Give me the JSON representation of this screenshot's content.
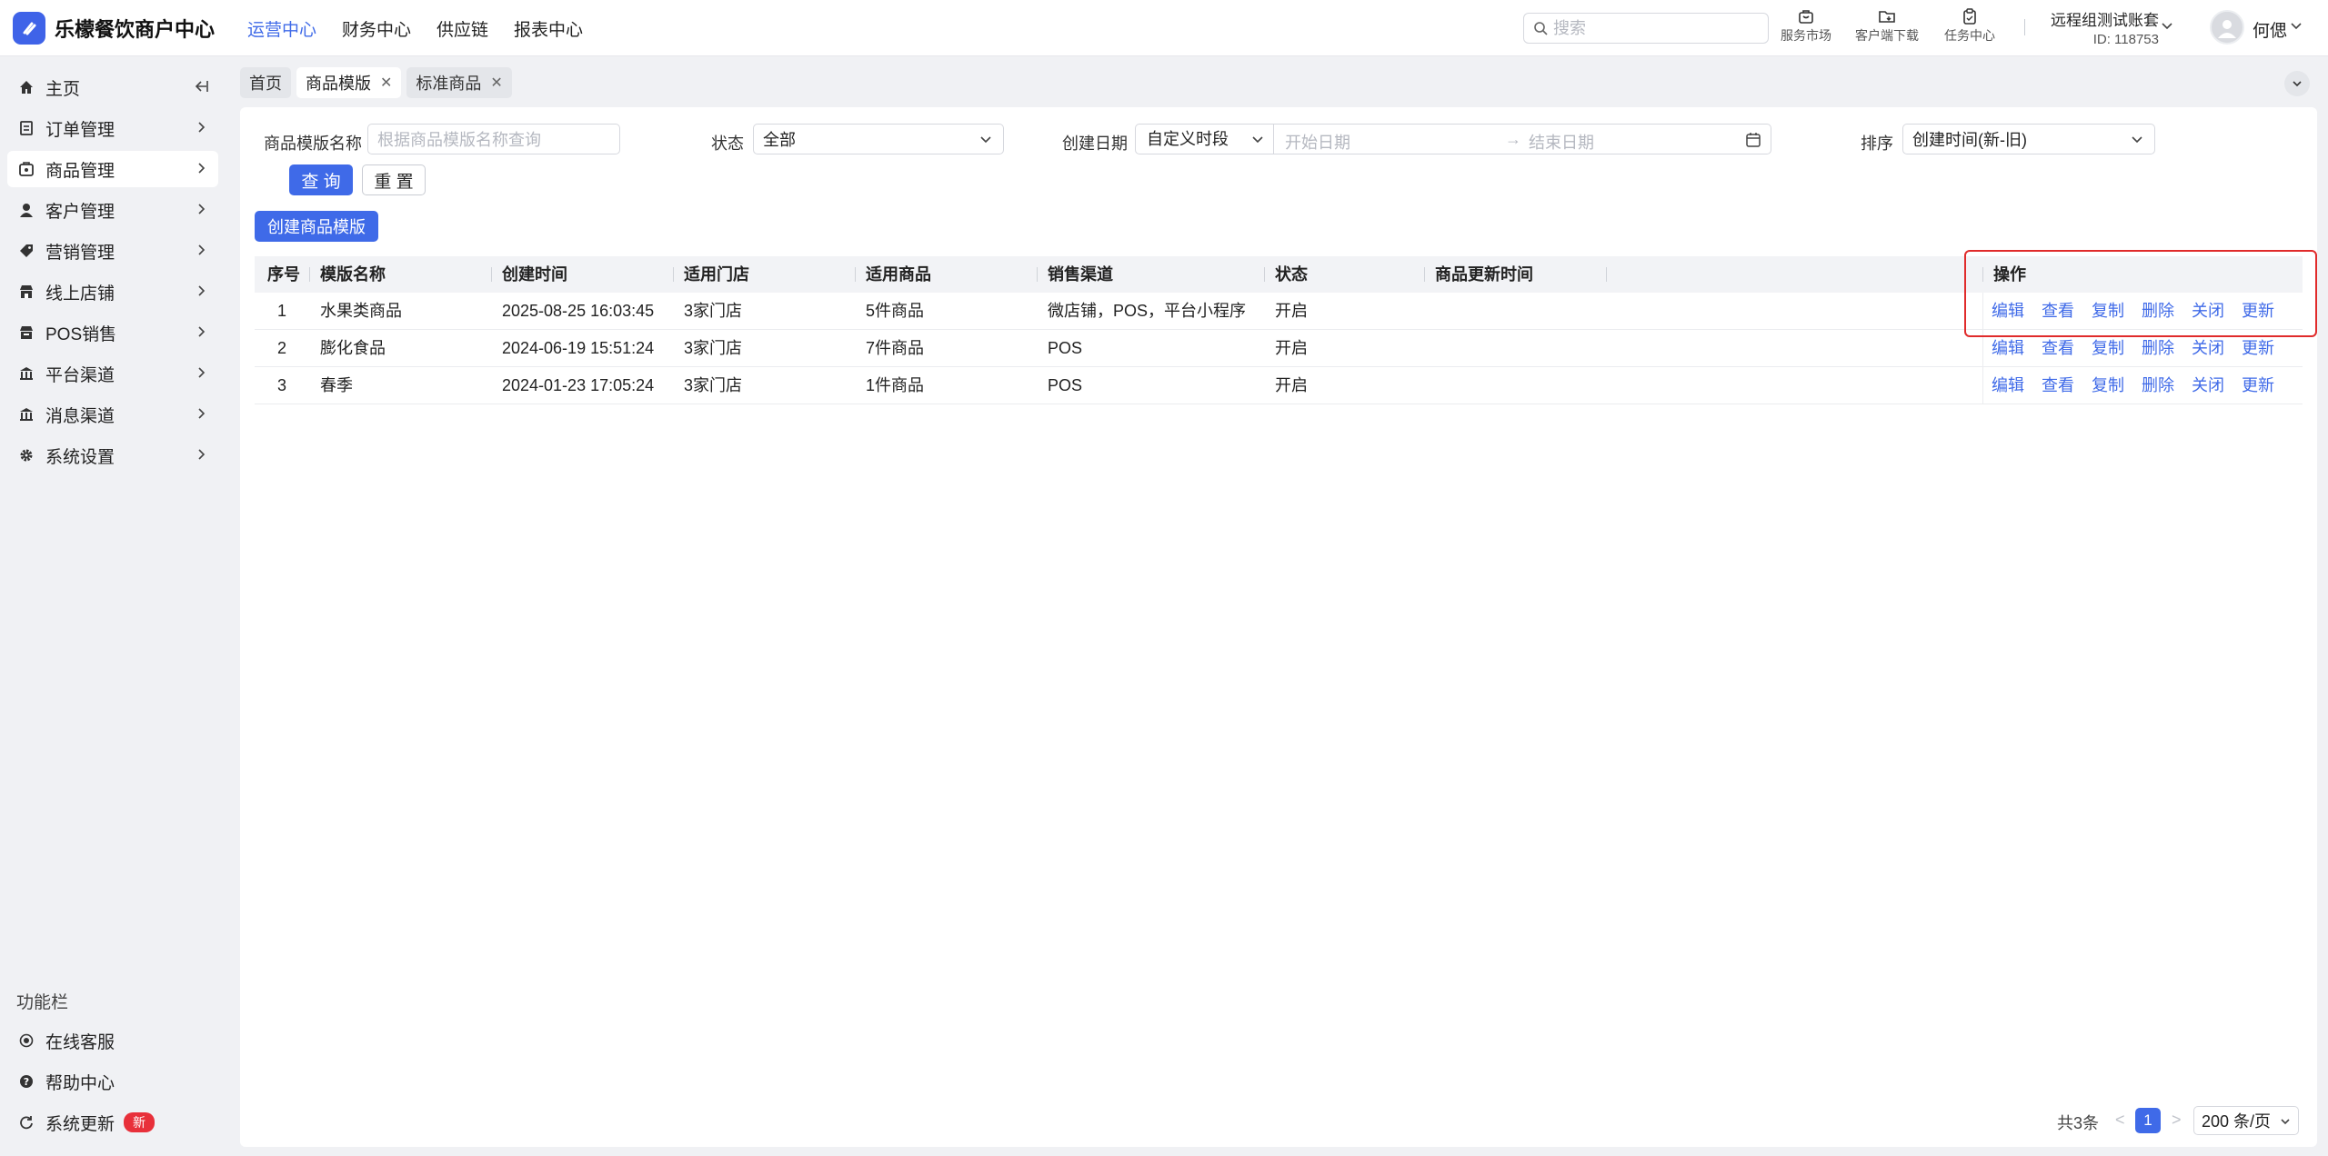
{
  "brand": {
    "name": "乐檬餐饮商户中心"
  },
  "topnav": [
    "运营中心",
    "财务中心",
    "供应链",
    "报表中心"
  ],
  "search": {
    "placeholder": "搜索"
  },
  "tools": [
    "服务市场",
    "客户端下载",
    "任务中心"
  ],
  "account": {
    "name": "远程组测试账套",
    "id": "ID: 118753"
  },
  "user": {
    "name": "何偲"
  },
  "sidebar": {
    "items": [
      {
        "label": "主页",
        "icon": "home-icon"
      },
      {
        "label": "订单管理",
        "icon": "order-icon"
      },
      {
        "label": "商品管理",
        "icon": "product-icon"
      },
      {
        "label": "客户管理",
        "icon": "user-icon"
      },
      {
        "label": "营销管理",
        "icon": "tag-icon"
      },
      {
        "label": "线上店铺",
        "icon": "shop-icon"
      },
      {
        "label": "POS销售",
        "icon": "pos-icon"
      },
      {
        "label": "平台渠道",
        "icon": "bank-icon"
      },
      {
        "label": "消息渠道",
        "icon": "message-icon"
      },
      {
        "label": "系统设置",
        "icon": "gear-icon"
      }
    ],
    "func_title": "功能栏",
    "func_items": [
      {
        "label": "在线客服",
        "icon": "headset-icon"
      },
      {
        "label": "帮助中心",
        "icon": "help-icon"
      },
      {
        "label": "系统更新",
        "icon": "refresh-icon",
        "badge": "新"
      }
    ]
  },
  "tabs": [
    "首页",
    "商品模版",
    "标准商品"
  ],
  "filters": {
    "name_label": "商品模版名称",
    "name_placeholder": "根据商品模版名称查询",
    "status_label": "状态",
    "status_value": "全部",
    "date_label": "创建日期",
    "date_type": "自定义时段",
    "start_placeholder": "开始日期",
    "end_placeholder": "结束日期",
    "date_arrow": "→",
    "sort_label": "排序",
    "sort_value": "创建时间(新-旧)",
    "query_button": "查 询",
    "reset_button": "重 置",
    "create_button": "创建商品模版"
  },
  "table": {
    "columns": [
      "序号",
      "模版名称",
      "创建时间",
      "适用门店",
      "适用商品",
      "销售渠道",
      "状态",
      "商品更新时间",
      "操作"
    ],
    "actions": [
      "编辑",
      "查看",
      "复制",
      "删除",
      "关闭",
      "更新"
    ],
    "rows": [
      {
        "index": "1",
        "name": "水果类商品",
        "created": "2025-08-25 16:03:45",
        "stores": "3家门店",
        "products": "5件商品",
        "channels": "微店铺，POS，平台小程序",
        "status": "开启",
        "updated": ""
      },
      {
        "index": "2",
        "name": "膨化食品",
        "created": "2024-06-19 15:51:24",
        "stores": "3家门店",
        "products": "7件商品",
        "channels": "POS",
        "status": "开启",
        "updated": ""
      },
      {
        "index": "3",
        "name": "春季",
        "created": "2024-01-23 17:05:24",
        "stores": "3家门店",
        "products": "1件商品",
        "channels": "POS",
        "status": "开启",
        "updated": ""
      }
    ]
  },
  "pagination": {
    "total": "共3条",
    "prev": "<",
    "page": "1",
    "next": ">",
    "page_size": "200 条/页"
  },
  "colors": {
    "accent": "#3f6ae8",
    "highlight": "#e02b2b",
    "badge": "#e8303a"
  }
}
